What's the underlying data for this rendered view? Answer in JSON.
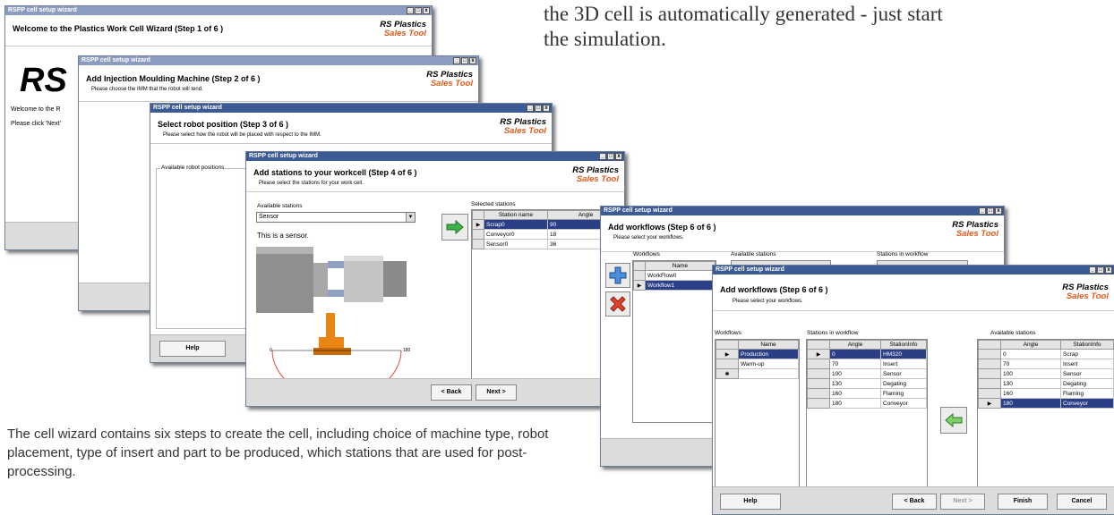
{
  "captions": {
    "top_right_line1": "the 3D cell is automatically generated - just start",
    "top_right_line2": "the simulation.",
    "bottom_left": "The cell wizard contains six steps to create the cell, including choice of machine type, robot placement, type of insert and part to be produced, which stations that are used for post-processing."
  },
  "window_title": "RSPP cell setup wizard",
  "logo": {
    "line1": "RS Plastics",
    "line2": "Sales Tool"
  },
  "win1": {
    "step": "Welcome to the Plastics Work Cell Wizard (Step 1 of 6 )",
    "big_logo": "RS",
    "welcome": "Welcome to the R",
    "click_next": "Please click 'Next'"
  },
  "win2": {
    "step": "Add Injection Moulding Machine (Step 2 of 6 )",
    "sub": "Please choose the IMM that the robot will tend."
  },
  "win3": {
    "step": "Select robot position (Step 3 of 6 )",
    "sub": "Please select how the robot will be placed with respect to the IMM.",
    "group": "Available robot positions",
    "help": "Help"
  },
  "win4": {
    "step": "Add stations to your workcell (Step 4 of 6 )",
    "sub": "Please select the stations for your work cell.",
    "available_label": "Available stations",
    "dropdown_value": "Sensor",
    "description": "This is a sensor.",
    "selected_label": "Selected stations",
    "columns": [
      "Station name",
      "Angle"
    ],
    "rows": [
      {
        "name": "Scrap0",
        "angle": "90"
      },
      {
        "name": "Conveyor0",
        "angle": "18"
      },
      {
        "name": "Sensor0",
        "angle": "36"
      }
    ],
    "arc_left": "0",
    "arc_right": "180",
    "back": "< Back",
    "next": "Next >"
  },
  "win5": {
    "step": "Add workflows (Step 6 of 6 )",
    "sub": "Please select your workflows.",
    "workflows_label": "Workflows",
    "available_label": "Available stations",
    "in_workflow_label": "Stations in workflow",
    "name_col": "Name",
    "rows": [
      "WorkFlow0",
      "Workflow1"
    ]
  },
  "win6": {
    "step": "Add workflows (Step 6 of 6 )",
    "sub": "Please select your workflows.",
    "workflows_label": "Workflows",
    "in_workflow_label": "Stations in workflow",
    "available_label": "Available stations",
    "name_col": "Name",
    "workflows": [
      "Production",
      "Warm-up"
    ],
    "angle_col": "Angle",
    "info_col": "StationInfo",
    "in_workflow": [
      {
        "angle": "0",
        "info": "HM320"
      },
      {
        "angle": "70",
        "info": "Insert"
      },
      {
        "angle": "100",
        "info": "Sensor"
      },
      {
        "angle": "130",
        "info": "Degating"
      },
      {
        "angle": "160",
        "info": "Flaming"
      },
      {
        "angle": "180",
        "info": "Conveyor"
      }
    ],
    "available": [
      {
        "angle": "0",
        "info": "Scrap"
      },
      {
        "angle": "70",
        "info": "Insert"
      },
      {
        "angle": "100",
        "info": "Sensor"
      },
      {
        "angle": "130",
        "info": "Degating"
      },
      {
        "angle": "160",
        "info": "Flaming"
      },
      {
        "angle": "180",
        "info": "Conveyor"
      }
    ],
    "help": "Help",
    "back": "< Back",
    "next": "Next >",
    "finish": "Finish",
    "cancel": "Cancel"
  }
}
